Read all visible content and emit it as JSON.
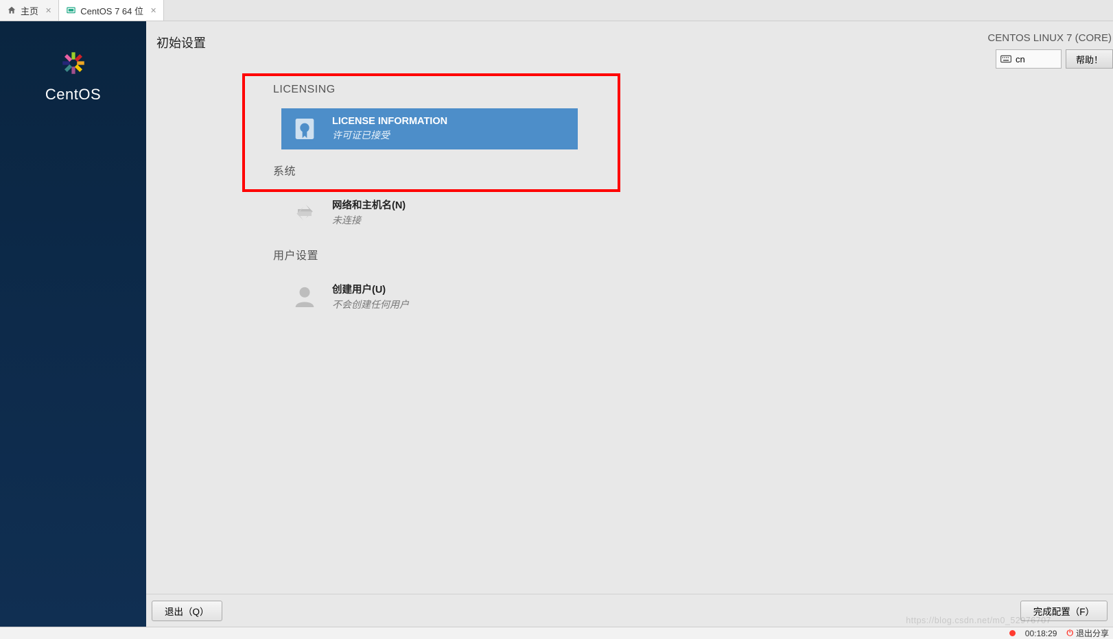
{
  "tabs": {
    "home": "主页",
    "vm": "CentOS 7 64 位"
  },
  "sidebar": {
    "brand": "CentOS"
  },
  "page": {
    "title": "初始设置",
    "distro": "CENTOS LINUX 7 (CORE)",
    "lang_code": "cn",
    "help_label": "帮助！"
  },
  "sections": {
    "licensing": {
      "header": "LICENSING"
    },
    "system": {
      "header": "系统"
    },
    "user": {
      "header": "用户设置"
    }
  },
  "spokes": {
    "license": {
      "title": "LICENSE INFORMATION",
      "status": "许可证已接受"
    },
    "network": {
      "title": "网络和主机名(N)",
      "status": "未连接"
    },
    "user": {
      "title": "创建用户(U)",
      "status": "不会创建任何用户"
    }
  },
  "actions": {
    "quit": "退出（Q）",
    "finish": "完成配置（F）"
  },
  "statusbar": {
    "time": "00:18:29",
    "exit_share": "退出分享"
  },
  "watermark": "https://blog.csdn.net/m0_52976707"
}
